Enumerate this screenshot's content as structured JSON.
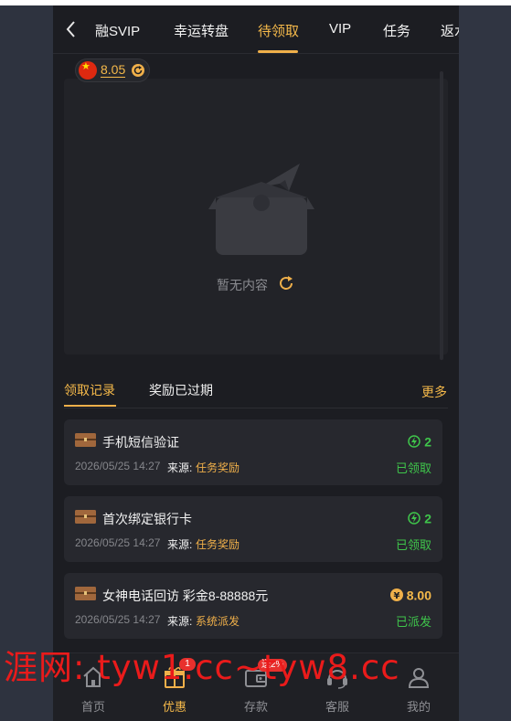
{
  "header": {
    "tabs": [
      {
        "label": "融SVIP",
        "active": false
      },
      {
        "label": "幸运转盘",
        "active": false
      },
      {
        "label": "待领取",
        "active": true
      },
      {
        "label": "VIP",
        "active": false
      },
      {
        "label": "任务",
        "active": false
      },
      {
        "label": "返水",
        "active": false
      }
    ]
  },
  "balance": {
    "value": "8.05"
  },
  "empty": {
    "text": "暂无内容"
  },
  "records": {
    "tabs": [
      "领取记录",
      "奖励已过期"
    ],
    "more": "更多",
    "source_label": "来源:",
    "items": [
      {
        "title": "手机短信验证",
        "date": "2026/05/25 14:27",
        "source": "任务奖励",
        "amount": "2",
        "amount_type": "lightning",
        "status": "已领取"
      },
      {
        "title": "首次绑定银行卡",
        "date": "2026/05/25 14:27",
        "source": "任务奖励",
        "amount": "2",
        "amount_type": "lightning",
        "status": "已领取"
      },
      {
        "title": "女神电话回访 彩金8-88888元",
        "date": "2026/05/25 14:27",
        "source": "系统派发",
        "amount": "8.00",
        "amount_type": "yen",
        "status": "已派发"
      }
    ]
  },
  "nav": {
    "items": [
      {
        "label": "首页",
        "icon": "home-icon"
      },
      {
        "label": "优惠",
        "icon": "gift-icon",
        "badge": "1"
      },
      {
        "label": "存款",
        "icon": "wallet-icon",
        "badge": "送2%"
      },
      {
        "label": "客服",
        "icon": "headset-icon"
      },
      {
        "label": "我的",
        "icon": "user-icon"
      }
    ]
  },
  "watermark": {
    "text": "涯网: tyw1.cc~tyw8.cc"
  },
  "colors": {
    "accent": "#f5b94a",
    "success": "#3fc54b",
    "badge": "#e8302d",
    "background": "#1c1d22"
  }
}
